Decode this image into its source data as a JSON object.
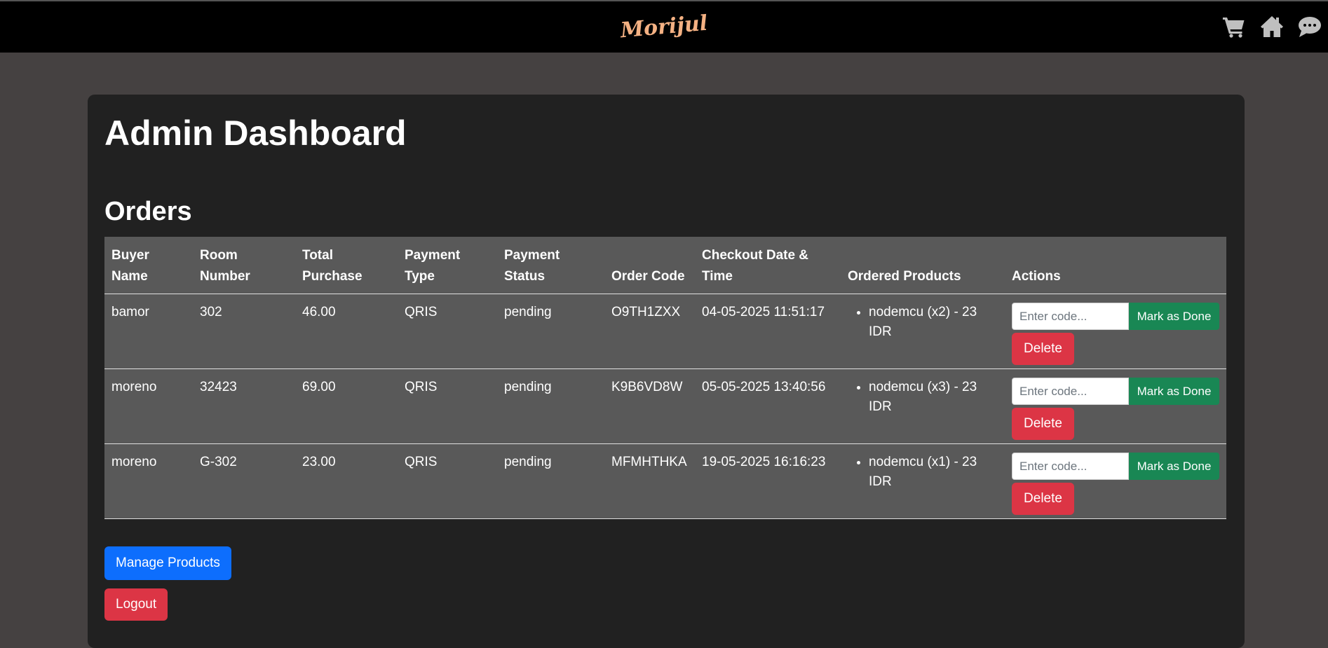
{
  "navbar": {
    "brand": "Morijul",
    "icons": [
      "cart-icon",
      "home-icon",
      "chat-icon"
    ]
  },
  "main": {
    "title": "Admin Dashboard",
    "orders_heading": "Orders",
    "columns": [
      "Buyer Name",
      "Room Number",
      "Total Purchase",
      "Payment Type",
      "Payment Status",
      "Order Code",
      "Checkout Date & Time",
      "Ordered Products",
      "Actions"
    ],
    "orders": [
      {
        "buyer": "bamor",
        "room": "302",
        "total": "46.00",
        "payment_type": "QRIS",
        "payment_status": "pending",
        "order_code": "O9TH1ZXX",
        "checkout": "04-05-2025 11:51:17",
        "products": [
          "nodemcu (x2) - 23 IDR"
        ]
      },
      {
        "buyer": "moreno",
        "room": "32423",
        "total": "69.00",
        "payment_type": "QRIS",
        "payment_status": "pending",
        "order_code": "K9B6VD8W",
        "checkout": "05-05-2025 13:40:56",
        "products": [
          "nodemcu (x3) - 23 IDR"
        ]
      },
      {
        "buyer": "moreno",
        "room": "G-302",
        "total": "23.00",
        "payment_type": "QRIS",
        "payment_status": "pending",
        "order_code": "MFMHTHKA",
        "checkout": "19-05-2025 16:16:23",
        "products": [
          "nodemcu (x1) - 23 IDR"
        ]
      }
    ],
    "actions": {
      "code_placeholder": "Enter code...",
      "done_label": "Mark as Done",
      "delete_label": "Delete"
    },
    "manage_products_label": "Manage Products",
    "logout_label": "Logout"
  },
  "colors": {
    "page_bg": "#454141",
    "navbar_bg": "#000000",
    "card_bg": "#212121",
    "table_bg": "#595959",
    "brand": "#f4b183",
    "success": "#198754",
    "danger": "#dc3545",
    "primary": "#0d6efd"
  }
}
